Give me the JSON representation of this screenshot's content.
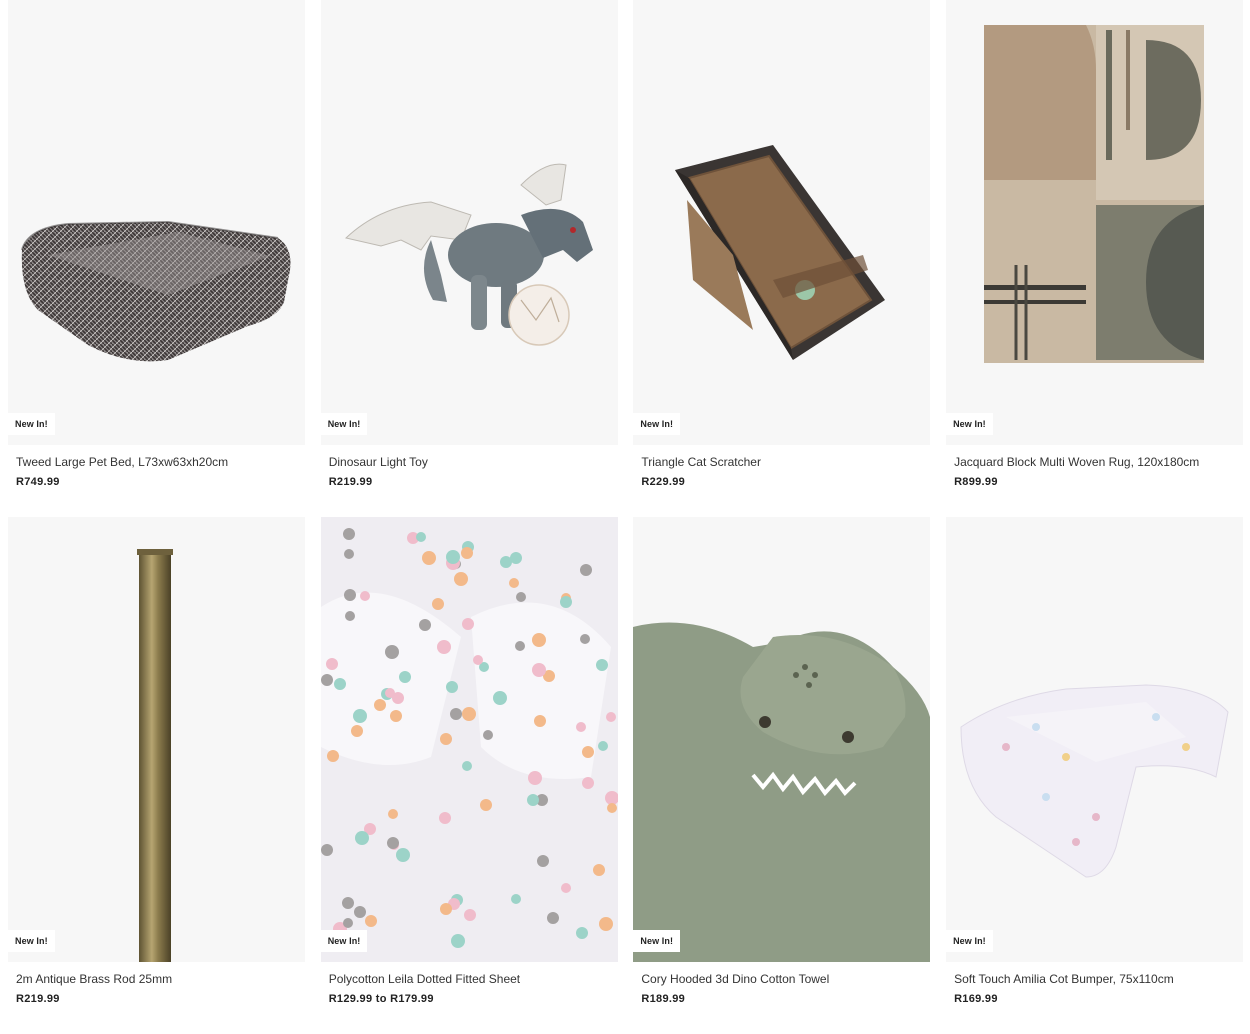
{
  "products": [
    {
      "title": "Tweed Large Pet Bed, L73xw63xh20cm",
      "price": "R749.99",
      "badge": "New In!",
      "image": "pet-bed-image"
    },
    {
      "title": "Dinosaur Light Toy",
      "price": "R219.99",
      "badge": "New In!",
      "image": "dinosaur-toy-image"
    },
    {
      "title": "Triangle Cat Scratcher",
      "price": "R229.99",
      "badge": "New In!",
      "image": "cat-scratcher-image"
    },
    {
      "title": "Jacquard Block Multi Woven Rug, 120x180cm",
      "price": "R899.99",
      "badge": "New In!",
      "image": "rug-image"
    },
    {
      "title": "2m Antique Brass Rod 25mm",
      "price": "R219.99",
      "badge": "New In!",
      "image": "brass-rod-image"
    },
    {
      "title": "Polycotton Leila Dotted Fitted Sheet",
      "price": "R129.99 to R179.99",
      "badge": "New In!",
      "image": "dotted-sheet-image"
    },
    {
      "title": "Cory Hooded 3d Dino Cotton Towel",
      "price": "R189.99",
      "badge": "New In!",
      "image": "dino-towel-image"
    },
    {
      "title": "Soft Touch Amilia Cot Bumper, 75x110cm",
      "price": "R169.99",
      "badge": "New In!",
      "image": "cot-bumper-image"
    }
  ]
}
